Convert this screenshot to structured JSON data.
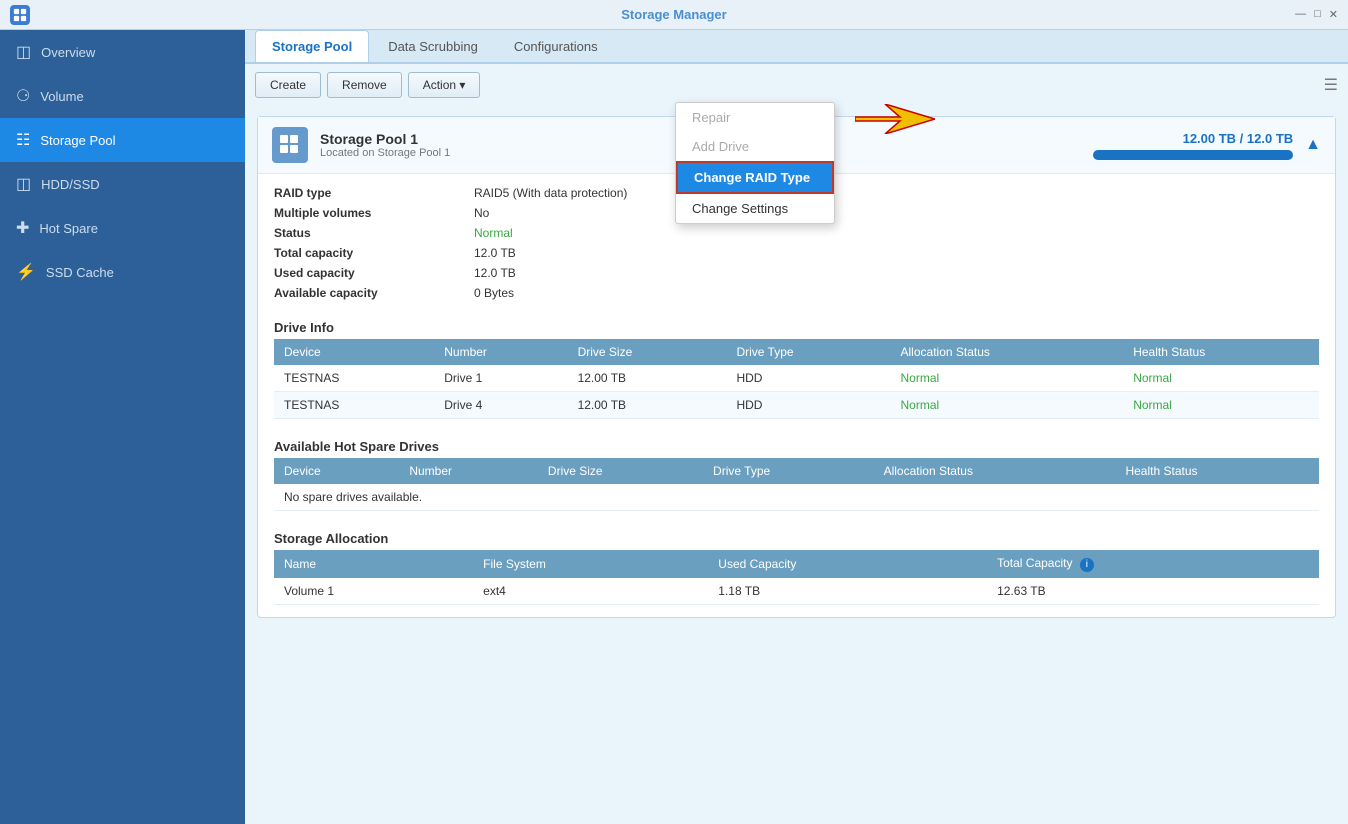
{
  "titlebar": {
    "title": "Storage Manager",
    "controls": [
      "minimize",
      "restore",
      "close"
    ]
  },
  "sidebar": {
    "items": [
      {
        "id": "overview",
        "label": "Overview",
        "icon": "grid"
      },
      {
        "id": "volume",
        "label": "Volume",
        "icon": "users"
      },
      {
        "id": "storage-pool",
        "label": "Storage Pool",
        "icon": "table"
      },
      {
        "id": "hdd-ssd",
        "label": "HDD/SSD",
        "icon": "monitor"
      },
      {
        "id": "hot-spare",
        "label": "Hot Spare",
        "icon": "plus-square"
      },
      {
        "id": "ssd-cache",
        "label": "SSD Cache",
        "icon": "flash"
      }
    ]
  },
  "tabs": [
    {
      "id": "storage-pool",
      "label": "Storage Pool",
      "active": true
    },
    {
      "id": "data-scrubbing",
      "label": "Data Scrubbing",
      "active": false
    },
    {
      "id": "configurations",
      "label": "Configurations",
      "active": false
    }
  ],
  "toolbar": {
    "create_label": "Create",
    "remove_label": "Remove",
    "action_label": "Action ▾"
  },
  "dropdown": {
    "items": [
      {
        "id": "repair",
        "label": "Repair",
        "disabled": true
      },
      {
        "id": "add-drive",
        "label": "Add Drive",
        "disabled": true
      },
      {
        "id": "change-raid-type",
        "label": "Change RAID Type",
        "highlighted": true
      },
      {
        "id": "change-settings",
        "label": "Change Settings",
        "disabled": false
      }
    ]
  },
  "pool": {
    "title": "Storage Pool 1",
    "subtitle": "Located on Storage Pool 1",
    "capacity_display": "12.00 TB / 12.0  TB",
    "capacity_percent": 100,
    "fields": {
      "raid_type_label": "RAID type",
      "raid_type_value": "RAID5  (With data protection)",
      "multiple_volumes_label": "Multiple volumes",
      "multiple_volumes_value": "No",
      "status_label": "Status",
      "status_value": "Normal",
      "total_capacity_label": "Total capacity",
      "total_capacity_value": "12.0  TB",
      "used_capacity_label": "Used capacity",
      "used_capacity_value": "12.0  TB",
      "available_capacity_label": "Available capacity",
      "available_capacity_value": "0 Bytes"
    }
  },
  "drive_info": {
    "section_title": "Drive Info",
    "columns": [
      "Device",
      "Number",
      "Drive Size",
      "Drive Type",
      "Allocation Status",
      "Health Status"
    ],
    "rows": [
      {
        "device": "TESTNAS",
        "number": "Drive 1",
        "size": "12.00 TB",
        "type": "HDD",
        "allocation": "Normal",
        "health": "Normal"
      },
      {
        "device": "TESTNAS",
        "number": "Drive 4",
        "size": "12.00 TB",
        "type": "HDD",
        "allocation": "Normal",
        "health": "Normal"
      }
    ]
  },
  "hot_spare": {
    "section_title": "Available Hot Spare Drives",
    "columns": [
      "Device",
      "Number",
      "Drive Size",
      "Drive Type",
      "Allocation Status",
      "Health Status"
    ],
    "no_data_message": "No spare drives available."
  },
  "storage_allocation": {
    "section_title": "Storage Allocation",
    "columns": [
      "Name",
      "File System",
      "Used Capacity",
      "Total Capacity"
    ],
    "rows": [
      {
        "name": "Volume 1",
        "filesystem": "ext4",
        "used": "1.18 TB",
        "total": "12.63 TB"
      }
    ]
  }
}
